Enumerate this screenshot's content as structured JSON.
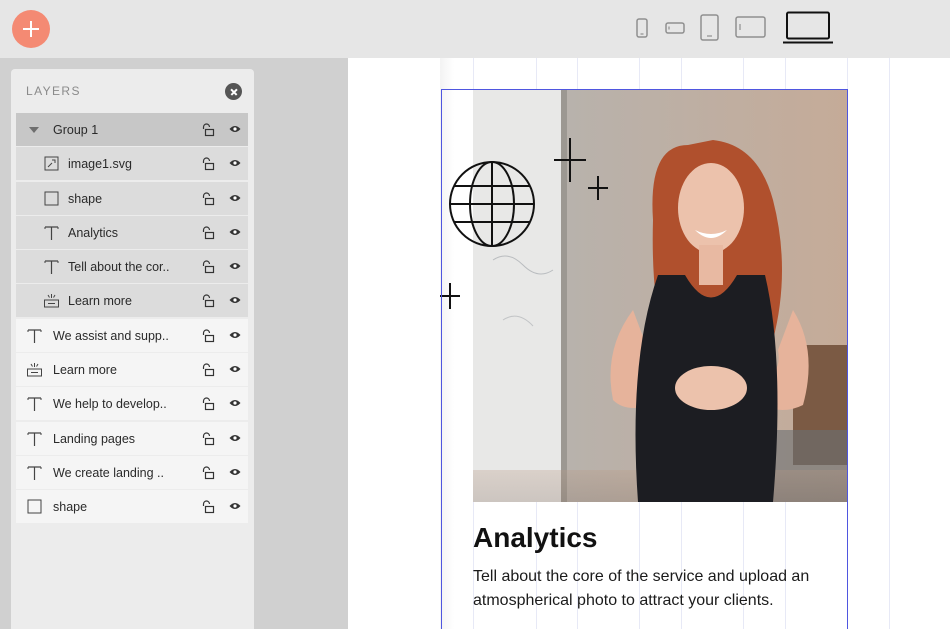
{
  "toolbar": {
    "add_icon": "plus-icon",
    "add_color": "#f48a73",
    "devices": [
      "mobile-portrait-icon",
      "mobile-landscape-icon",
      "tablet-portrait-icon",
      "tablet-landscape-icon",
      "laptop-icon"
    ],
    "active_device": "laptop-icon"
  },
  "layers": {
    "title": "LAYERS",
    "close_icon": "close-icon",
    "items": [
      {
        "label": "Group 1",
        "icon": "caret-down-icon",
        "level": "group"
      },
      {
        "label": "image1.svg",
        "icon": "image-icon",
        "level": "child"
      },
      {
        "label": "shape",
        "icon": "square-icon",
        "level": "child"
      },
      {
        "label": "Analytics",
        "icon": "text-icon",
        "level": "child"
      },
      {
        "label": "Tell about the cor..",
        "icon": "text-icon",
        "level": "child"
      },
      {
        "label": "Learn more",
        "icon": "button-icon",
        "level": "child"
      },
      {
        "label": "We assist and supp..",
        "icon": "text-icon",
        "level": "root"
      },
      {
        "label": "Learn more",
        "icon": "button-icon",
        "level": "root"
      },
      {
        "label": "We help to develop..",
        "icon": "text-icon",
        "level": "root"
      },
      {
        "label": "Landing pages",
        "icon": "text-icon",
        "level": "root"
      },
      {
        "label": "We create landing ..",
        "icon": "text-icon",
        "level": "root"
      },
      {
        "label": "shape",
        "icon": "square-icon",
        "level": "root"
      }
    ]
  },
  "canvas": {
    "card_title": "Analytics",
    "card_description": "Tell about the core of the service and upload an atmospherical photo to attract your clients.",
    "selection_color": "#4f56e0"
  }
}
